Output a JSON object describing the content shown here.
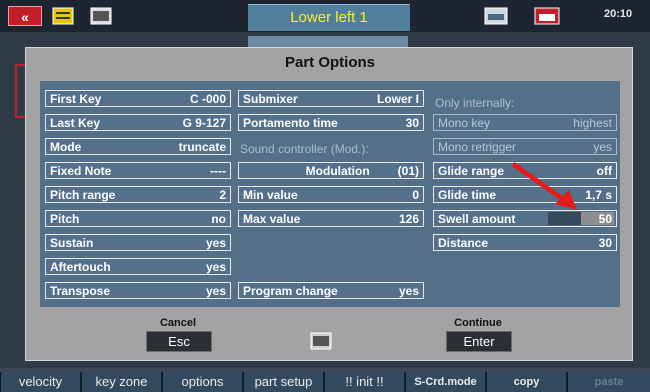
{
  "topbar": {
    "back_icon": "double-chevron-left-icon",
    "title": "Lower left 1",
    "time": "20:10"
  },
  "dialog": {
    "title": "Part Options",
    "col1": [
      {
        "label": "First Key",
        "value": "C  -000"
      },
      {
        "label": "Last Key",
        "value": "G 9-127"
      },
      {
        "label": "Mode",
        "value": "truncate"
      },
      {
        "label": "Fixed Note",
        "value": "----"
      },
      {
        "label": "Pitch range",
        "value": "2"
      },
      {
        "label": "Pitch",
        "value": "no"
      },
      {
        "label": "Sustain",
        "value": "yes"
      },
      {
        "label": "Aftertouch",
        "value": "yes"
      },
      {
        "label": "Transpose",
        "value": "yes"
      }
    ],
    "col2": {
      "submixer": {
        "label": "Submixer",
        "value": "Lower I"
      },
      "portamento": {
        "label": "Portamento time",
        "value": "30"
      },
      "sound_controller_heading": "Sound controller (Mod.):",
      "modulation": {
        "label": "Modulation",
        "value": "(01)"
      },
      "min_value": {
        "label": "Min value",
        "value": "0"
      },
      "max_value": {
        "label": "Max value",
        "value": "126"
      },
      "program_change": {
        "label": "Program change",
        "value": "yes"
      }
    },
    "col3": {
      "heading": "Only internally:",
      "mono_key": {
        "label": "Mono key",
        "value": "highest"
      },
      "mono_retrigger": {
        "label": "Mono retrigger",
        "value": "yes"
      },
      "glide_range": {
        "label": "Glide range",
        "value": "off"
      },
      "glide_time": {
        "label": "Glide time",
        "value": "1,7 s"
      },
      "swell_amount": {
        "label": "Swell amount",
        "value": "50",
        "level_fraction": 0.5
      },
      "distance": {
        "label": "Distance",
        "value": "30"
      }
    },
    "cancel_label": "Cancel",
    "esc_label": "Esc",
    "continue_label": "Continue",
    "enter_label": "Enter"
  },
  "bottombar": {
    "velocity": "velocity",
    "key_zone": "key zone",
    "options": "options",
    "part_setup": "part setup",
    "init": "!! init !!",
    "scrd_mode": "S-Crd.mode",
    "copy": "copy",
    "paste": "paste"
  },
  "colors": {
    "accent_red": "#c41d2a",
    "panel_blue": "#546f88",
    "title_yellow": "#ffeb3b"
  }
}
